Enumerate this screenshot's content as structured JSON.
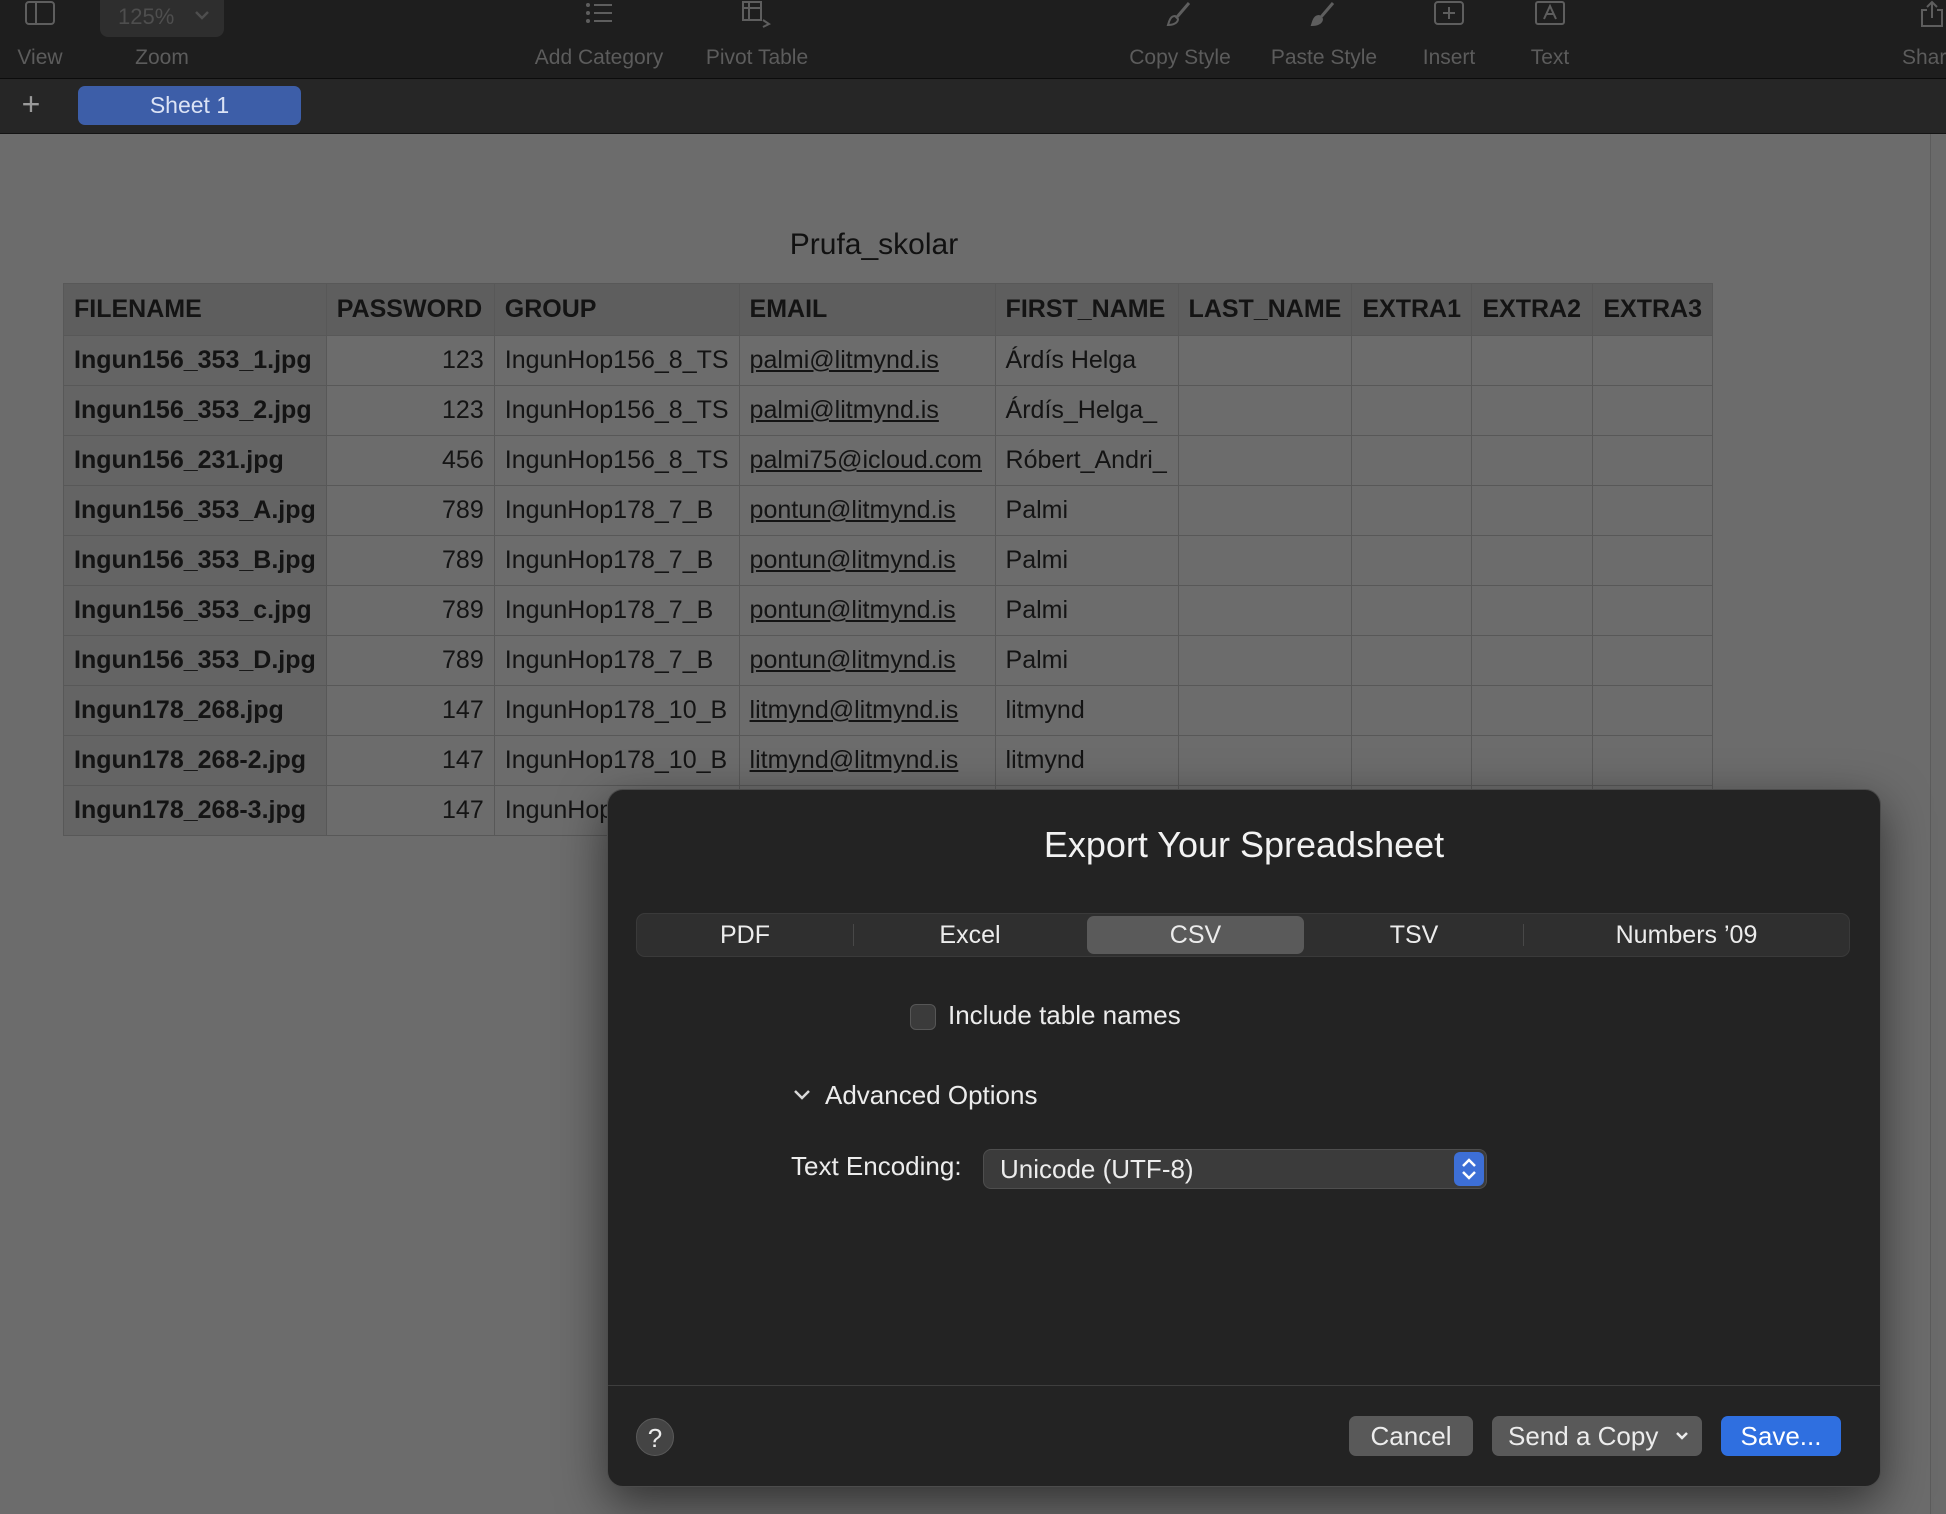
{
  "toolbar": {
    "view_label": "View",
    "zoom_label": "Zoom",
    "zoom_value": "125%",
    "add_category_label": "Add Category",
    "pivot_table_label": "Pivot Table",
    "copy_style_label": "Copy Style",
    "paste_style_label": "Paste Style",
    "insert_label": "Insert",
    "text_label": "Text",
    "share_label": "Shar"
  },
  "tabs": {
    "add_label": "+",
    "sheet_label": "Sheet 1"
  },
  "table": {
    "title": "Prufa_skolar",
    "headers": [
      "FILENAME",
      "PASSWORD",
      "GROUP",
      "EMAIL",
      "FIRST_NAME",
      "LAST_NAME",
      "EXTRA1",
      "EXTRA2",
      "EXTRA3"
    ],
    "rows": [
      [
        "Ingun156_353_1.jpg",
        "123",
        "IngunHop156_8_TS",
        "palmi@litmynd.is",
        "Árdís Helga",
        "",
        "",
        "",
        ""
      ],
      [
        "Ingun156_353_2.jpg",
        "123",
        "IngunHop156_8_TS",
        "palmi@litmynd.is",
        "Árdís_Helga_",
        "",
        "",
        "",
        ""
      ],
      [
        "Ingun156_231.jpg",
        "456",
        "IngunHop156_8_TS",
        "palmi75@icloud.com",
        "Róbert_Andri_",
        "",
        "",
        "",
        ""
      ],
      [
        "Ingun156_353_A.jpg",
        "789",
        "IngunHop178_7_B",
        "pontun@litmynd.is",
        "Palmi",
        "",
        "",
        "",
        ""
      ],
      [
        "Ingun156_353_B.jpg",
        "789",
        "IngunHop178_7_B",
        "pontun@litmynd.is",
        "Palmi",
        "",
        "",
        "",
        ""
      ],
      [
        "Ingun156_353_c.jpg",
        "789",
        "IngunHop178_7_B",
        "pontun@litmynd.is",
        "Palmi",
        "",
        "",
        "",
        ""
      ],
      [
        "Ingun156_353_D.jpg",
        "789",
        "IngunHop178_7_B",
        "pontun@litmynd.is",
        "Palmi",
        "",
        "",
        "",
        ""
      ],
      [
        "Ingun178_268.jpg",
        "147",
        "IngunHop178_10_B",
        "litmynd@litmynd.is",
        "litmynd",
        "",
        "",
        "",
        ""
      ],
      [
        "Ingun178_268-2.jpg",
        "147",
        "IngunHop178_10_B",
        "litmynd@litmynd.is",
        "litmynd",
        "",
        "",
        "",
        ""
      ],
      [
        "Ingun178_268-3.jpg",
        "147",
        "IngunHop1",
        "",
        "",
        "",
        "",
        "",
        ""
      ]
    ]
  },
  "dialog": {
    "title": "Export Your Spreadsheet",
    "formats": [
      "PDF",
      "Excel",
      "CSV",
      "TSV",
      "Numbers ’09"
    ],
    "selected_format": "CSV",
    "include_table_names_label": "Include table names",
    "include_table_names_checked": false,
    "advanced_options_label": "Advanced Options",
    "text_encoding_label": "Text Encoding:",
    "text_encoding_value": "Unicode (UTF-8)",
    "help_label": "?",
    "cancel_label": "Cancel",
    "send_copy_label": "Send a Copy",
    "save_label": "Save..."
  },
  "colors": {
    "accent": "#2f6fe0",
    "sheet_tab": "#3d5ea8",
    "dialog_bg": "#232323",
    "canvas_bg": "#6c6c6c"
  },
  "icons": {
    "view": "sidebar-icon",
    "zoom": "chevron-down-icon",
    "add_category": "list-icon",
    "pivot_table": "pivot-table-icon",
    "copy_style": "brush-icon",
    "paste_style": "brush-icon",
    "insert": "plus-square-icon",
    "text": "text-box-icon",
    "share": "share-icon"
  }
}
